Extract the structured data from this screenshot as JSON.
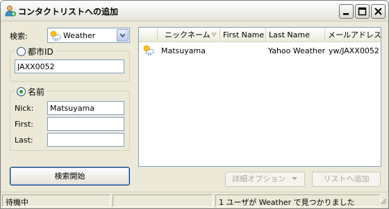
{
  "window": {
    "title": "コンタクトリストへの追加",
    "icon": "contact-add-icon"
  },
  "search": {
    "label": "検索:",
    "service_value": "Weather",
    "service_icon": "weather-icon"
  },
  "city_group": {
    "legend": "都市ID",
    "selected": false,
    "city_id_value": "JAXX0052"
  },
  "name_group": {
    "legend": "名前",
    "selected": true,
    "nick_label": "Nick:",
    "nick_value": "Matsuyama",
    "first_label": "First:",
    "first_value": "",
    "last_label": "Last:",
    "last_value": ""
  },
  "buttons": {
    "start_search": "検索開始",
    "detail_options": "詳細オプション",
    "add_to_list": "リストへ追加"
  },
  "results": {
    "columns": [
      "ニックネーム",
      "First Name",
      "Last Name",
      "メールアドレス"
    ],
    "rows": [
      {
        "icon": "weather-icon",
        "nickname": "Matsuyama",
        "first_name": "",
        "last_name": "Yahoo Weather",
        "email": "yw/JAXX0052"
      }
    ]
  },
  "status": {
    "state": "待機中",
    "middle": "",
    "message": "1 ユーザが Weather で見つかりました"
  }
}
